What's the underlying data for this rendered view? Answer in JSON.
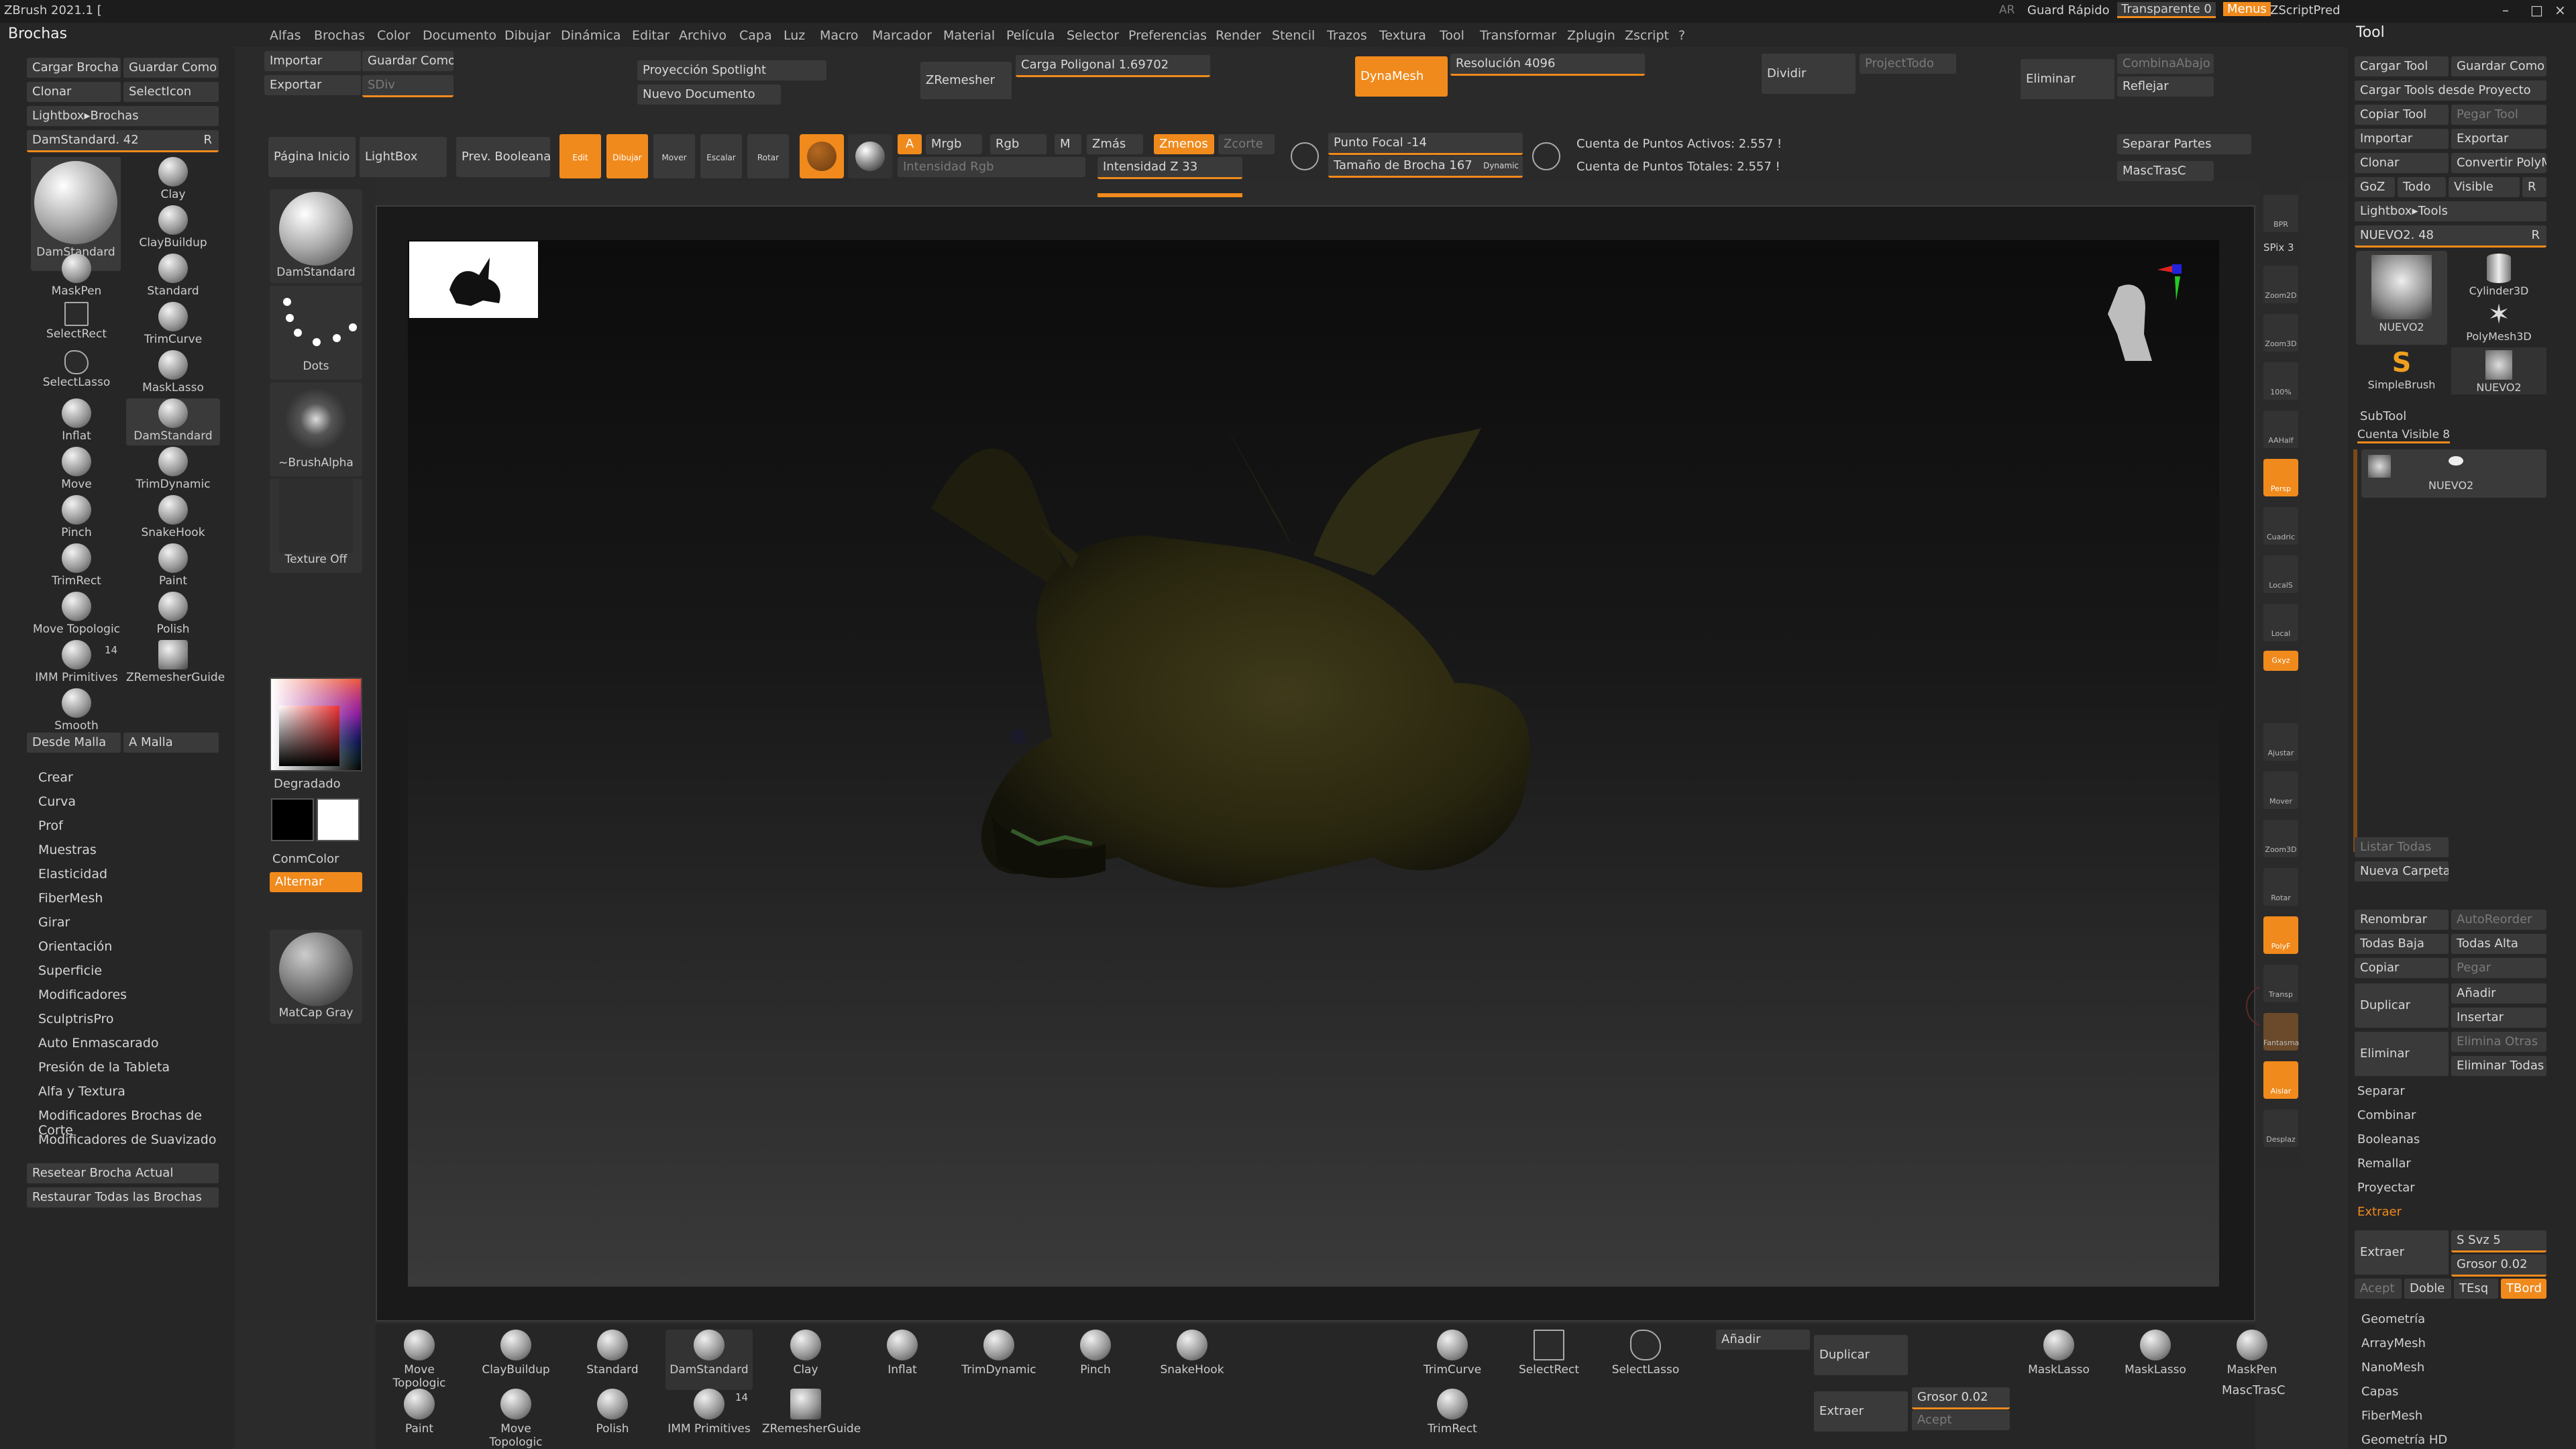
{
  "titlebar": {
    "app_title": "ZBrush 2021.1 [",
    "right_items": [
      "AR",
      "Guard Rápido",
      "Transparente 0",
      "Menus",
      "ZScriptPred"
    ]
  },
  "menubar": [
    "Alfas",
    "Brochas",
    "Color",
    "Documento",
    "Dibujar",
    "Dinámica",
    "Editar",
    "Archivo",
    "Capa",
    "Luz",
    "Macro",
    "Marcador",
    "Material",
    "Película",
    "Selector",
    "Preferencias",
    "Render",
    "Stencil",
    "Trazos",
    "Textura",
    "Tool",
    "Transformar",
    "Zplugin",
    "Zscript",
    "?"
  ],
  "left": {
    "header": "Brochas",
    "buttons": {
      "cargar": "Cargar Brocha",
      "guardar": "Guardar Como",
      "clonar": "Clonar",
      "selecticon": "SelectIcon",
      "lightbox": "Lightbox▸Brochas"
    },
    "current": "DamStandard. 42",
    "current_key": "R",
    "brushes": [
      "DamStandard",
      "Clay",
      "ClayBuildup",
      "MaskPen",
      "Standard",
      "SelectRect",
      "TrimCurve",
      "SelectLasso",
      "MaskLasso",
      "Inflat",
      "DamStandard",
      "Move",
      "TrimDynamic",
      "Pinch",
      "SnakeHook",
      "TrimRect",
      "Paint",
      "Move Topologic",
      "Polish",
      "IMM Primitives",
      "ZRemesherGuide",
      "Smooth"
    ],
    "imm_count": "14",
    "mesh_buttons": [
      "Desde Malla",
      "A Malla"
    ],
    "sections": [
      "Crear",
      "Curva",
      "Prof",
      "Muestras",
      "Elasticidad",
      "FiberMesh",
      "Girar",
      "Orientación",
      "Superficie",
      "Modificadores",
      "SculptrisPro",
      "Auto Enmascarado",
      "Presión de la Tableta",
      "Alfa y Textura",
      "Modificadores Brochas de Corte",
      "Modificadores de Suavizado"
    ],
    "reset_buttons": [
      "Resetear Brocha Actual",
      "Restaurar Todas las Brochas"
    ]
  },
  "toolbar": {
    "importar": "Importar",
    "guardar_como": "Guardar Como",
    "exportar": "Exportar",
    "sdiv": "SDiv",
    "proyeccion": "Proyección Spotlight",
    "nuevo_doc": "Nuevo Documento",
    "zremesher": "ZRemesher",
    "carga": "Carga Poligonal 1.69702",
    "dynamesh": "DynaMesh",
    "resolucion": "Resolución 4096",
    "dividir": "Dividir",
    "projecttodo": "ProjectTodo",
    "eliminar": "Eliminar",
    "combina": "CombinaAbajo",
    "reflejar": "Reflejar",
    "pagina": "Página Inicio",
    "lightbox": "LightBox",
    "prev": "Prev. Booleana",
    "edit": "Edit",
    "dibujar": "Dibujar",
    "mover": "Mover",
    "escalar": "Escalar",
    "rotar": "Rotar",
    "a": "A",
    "mrgb": "Mrgb",
    "rgb": "Rgb",
    "m": "M",
    "zmas": "Zmás",
    "zmenos": "Zmenos",
    "zcorte": "Zcorte",
    "intensidad_rgb": "Intensidad Rgb",
    "intensidad_z": "Intensidad Z 33",
    "punto_focal": "Punto Focal -14",
    "tamano": "Tamaño de Brocha 167",
    "dynamic": "Dynamic",
    "activos": "Cuenta de Puntos Activos: 2.557 !",
    "totales": "Cuenta de Puntos Totales: 2.557 !",
    "separar": "Separar Partes",
    "masctrasc": "MascTrasC"
  },
  "left_mid": {
    "brush": "DamStandard",
    "stroke": "Dots",
    "alpha": "~BrushAlpha",
    "texture": "Texture Off",
    "degradado": "Degradado",
    "conmcolor": "ConmColor",
    "alternar": "Alternar",
    "material": "MatCap Gray"
  },
  "right_shelf": [
    "BPR",
    "SPix 3",
    "Zoom2D",
    "Zoom3D",
    "100%",
    "AAHalf",
    "Persp",
    "Cuadric",
    "LocalS",
    "Local",
    "Gxyz",
    "Ajustar",
    "Mover",
    "Zoom3D",
    "Rotar",
    "PolyF",
    "Transp",
    "Fantasma",
    "Aislar",
    "Desplaz"
  ],
  "spix": "SPix 3",
  "right": {
    "header": "Tool",
    "rows": [
      [
        "Cargar Tool",
        "Guardar Como"
      ],
      [
        "Cargar Tools desde Proyecto",
        ""
      ],
      [
        "Copiar Tool",
        "Pegar Tool"
      ],
      [
        "Importar",
        "Exportar"
      ],
      [
        "Clonar",
        "Convertir PolyMesh3D"
      ],
      [
        "GoZ",
        "Todo",
        "Visible",
        "R"
      ]
    ],
    "lightbox": "Lightbox▸Tools",
    "current": "NUEVO2. 48",
    "current_key": "R",
    "thumbs": [
      "NUEVO2",
      "Cylinder3D",
      "NUEVO2",
      "PolyMesh3D",
      "SimpleBrush",
      "NUEVO2"
    ],
    "subtool": "SubTool",
    "visible": "Cuenta Visible 8",
    "subtool_name": "NUEVO2",
    "list_buttons": [
      "Listar Todas",
      "Nueva Carpeta",
      "Renombrar",
      "AutoReorder",
      "Todas Baja",
      "Todas Alta",
      "Copiar",
      "Pegar",
      "Duplicar",
      "Añadir",
      "Insertar",
      "Eliminar",
      "Elimina Otras",
      "Eliminar Todas"
    ],
    "sections": [
      "Separar",
      "Combinar",
      "Booleanas",
      "Remallar",
      "Proyectar",
      "Extraer"
    ],
    "extraer": {
      "btn": "Extraer",
      "ssvz": "S Svz 5",
      "grosor": "Grosor 0.02",
      "acept": "Acept",
      "doble": "Doble",
      "tesq": "TEsq",
      "tbord": "TBord"
    },
    "bottom_sections": [
      "Geometría",
      "ArrayMesh",
      "NanoMesh",
      "Capas",
      "FiberMesh",
      "Geometría HD"
    ]
  },
  "bottom": {
    "row1": [
      "Move Topologic",
      "ClayBuildup",
      "Standard",
      "DamStandard",
      "Clay",
      "Inflat",
      "TrimDynamic",
      "Pinch",
      "SnakeHook"
    ],
    "row2": [
      "Paint",
      "Move Topologic",
      "Polish",
      "IMM Primitives",
      "ZRemesherGuide"
    ],
    "imm_count": "14",
    "tools": [
      "TrimCurve",
      "SelectRect",
      "SelectLasso",
      "TrimRect"
    ],
    "anadir": "Añadir",
    "duplicar": "Duplicar",
    "extraer": "Extraer",
    "grosor": "Grosor 0.02",
    "acept": "Acept",
    "masks": [
      "MaskLasso",
      "MaskLasso",
      "MaskPen"
    ],
    "masctrasc": "MascTrasC"
  }
}
